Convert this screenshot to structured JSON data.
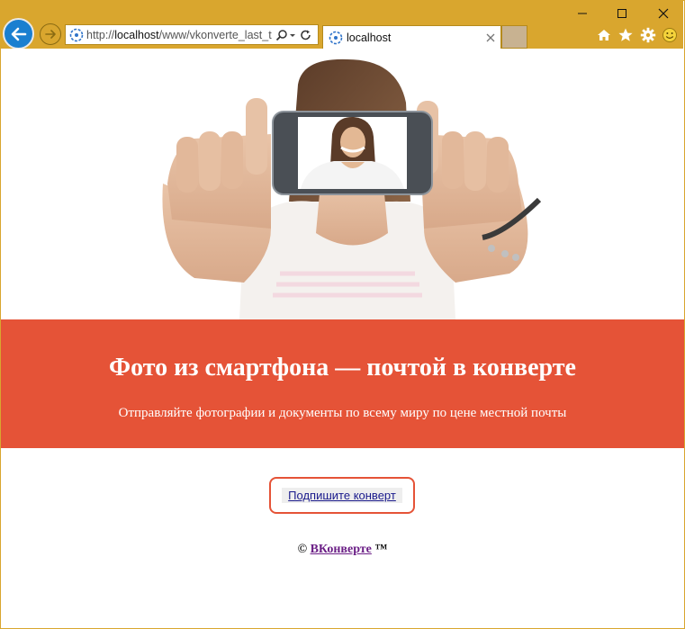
{
  "browser": {
    "address": {
      "prefix": "http://",
      "host": "localhost",
      "path": "/www/vkonverte_last_t"
    },
    "tab": {
      "label": "localhost"
    }
  },
  "page": {
    "headline": "Фото из смартфона — почтой в конверте",
    "subheadline": "Отправляйте фотографии и документы по всему миру по цене местной почты",
    "cta_label": "Подпишите конверт",
    "footer": {
      "copyright": "©",
      "brand": "ВКонверте",
      "tm": "™"
    }
  },
  "colors": {
    "chrome": "#d9a62e",
    "accent": "#e55337",
    "back_button": "#1a7fd0"
  }
}
